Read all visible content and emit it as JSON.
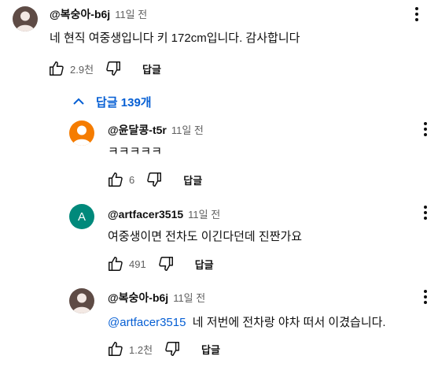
{
  "colors": {
    "accent": "#065fd4",
    "muted": "#606060",
    "text": "#0f0f0f"
  },
  "top_comment": {
    "author": "@복숭아-b6j",
    "time": "11일 전",
    "text": "네 현직 여중생입니다 키 172cm입니다. 감사합니다",
    "likes": "2.9천",
    "reply_label": "답글"
  },
  "replies_toggle": {
    "label": "답글 139개",
    "icon": "chevron-up-icon"
  },
  "replies": [
    {
      "author": "@윤달콩-t5r",
      "time": "11일 전",
      "text": "ㅋㅋㅋㅋㅋ",
      "likes": "6",
      "reply_label": "답글"
    },
    {
      "author": "@artfacer3515",
      "avatar_letter": "A",
      "time": "11일 전",
      "text": "여중생이면 전차도 이긴다던데 진짠가요",
      "likes": "491",
      "reply_label": "답글"
    },
    {
      "author": "@복숭아-b6j",
      "time": "11일 전",
      "mention": "@artfacer3515",
      "text": "네 저번에 전차랑 야차 떠서 이겼습니다.",
      "likes": "1.2천",
      "reply_label": "답글"
    }
  ]
}
